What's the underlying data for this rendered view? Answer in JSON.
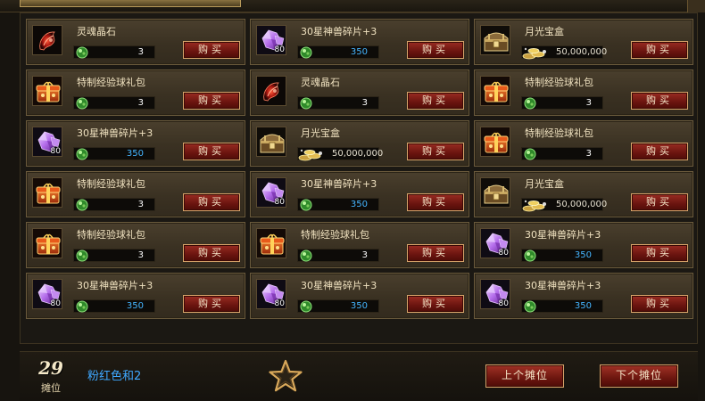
{
  "items": [
    {
      "name": "灵魂晶石",
      "icon": "soul-crystal-icon",
      "currency": "jade",
      "price": "3",
      "qty": "",
      "buy_label": "购买"
    },
    {
      "name": "30星神兽碎片+3",
      "icon": "purple-gem-icon",
      "currency": "jade",
      "price": "350",
      "qty": "80",
      "buy_label": "购买"
    },
    {
      "name": "月光宝盒",
      "icon": "treasure-chest-icon",
      "currency": "gold",
      "price": "50,000,000",
      "qty": "",
      "buy_label": "购买"
    },
    {
      "name": "特制经验球礼包",
      "icon": "gift-box-icon",
      "currency": "jade",
      "price": "3",
      "qty": "",
      "buy_label": "购买"
    },
    {
      "name": "灵魂晶石",
      "icon": "soul-crystal-icon",
      "currency": "jade",
      "price": "3",
      "qty": "",
      "buy_label": "购买"
    },
    {
      "name": "特制经验球礼包",
      "icon": "gift-box-icon",
      "currency": "jade",
      "price": "3",
      "qty": "",
      "buy_label": "购买"
    },
    {
      "name": "30星神兽碎片+3",
      "icon": "purple-gem-icon",
      "currency": "jade",
      "price": "350",
      "qty": "80",
      "buy_label": "购买"
    },
    {
      "name": "月光宝盒",
      "icon": "treasure-chest-icon",
      "currency": "gold",
      "price": "50,000,000",
      "qty": "",
      "buy_label": "购买"
    },
    {
      "name": "特制经验球礼包",
      "icon": "gift-box-icon",
      "currency": "jade",
      "price": "3",
      "qty": "",
      "buy_label": "购买"
    },
    {
      "name": "特制经验球礼包",
      "icon": "gift-box-icon",
      "currency": "jade",
      "price": "3",
      "qty": "",
      "buy_label": "购买"
    },
    {
      "name": "30星神兽碎片+3",
      "icon": "purple-gem-icon",
      "currency": "jade",
      "price": "350",
      "qty": "80",
      "buy_label": "购买"
    },
    {
      "name": "月光宝盒",
      "icon": "treasure-chest-icon",
      "currency": "gold",
      "price": "50,000,000",
      "qty": "",
      "buy_label": "购买"
    },
    {
      "name": "特制经验球礼包",
      "icon": "gift-box-icon",
      "currency": "jade",
      "price": "3",
      "qty": "",
      "buy_label": "购买"
    },
    {
      "name": "特制经验球礼包",
      "icon": "gift-box-icon",
      "currency": "jade",
      "price": "3",
      "qty": "",
      "buy_label": "购买"
    },
    {
      "name": "30星神兽碎片+3",
      "icon": "purple-gem-icon",
      "currency": "jade",
      "price": "350",
      "qty": "80",
      "buy_label": "购买"
    },
    {
      "name": "30星神兽碎片+3",
      "icon": "purple-gem-icon",
      "currency": "jade",
      "price": "350",
      "qty": "80",
      "buy_label": "购买"
    },
    {
      "name": "30星神兽碎片+3",
      "icon": "purple-gem-icon",
      "currency": "jade",
      "price": "350",
      "qty": "80",
      "buy_label": "购买"
    },
    {
      "name": "30星神兽碎片+3",
      "icon": "purple-gem-icon",
      "currency": "jade",
      "price": "350",
      "qty": "80",
      "buy_label": "购买"
    }
  ],
  "footer": {
    "booth_number": "29",
    "booth_label": "摊位",
    "owner_name": "粉红色和2",
    "favorite_icon": "star-icon",
    "prev_label": "上个摊位",
    "next_label": "下个摊位"
  },
  "colors": {
    "price_blue": "#45b5ff",
    "owner_blue": "#3fa8ff",
    "button_red": "#8a2018",
    "button_border": "#d7a46a"
  }
}
